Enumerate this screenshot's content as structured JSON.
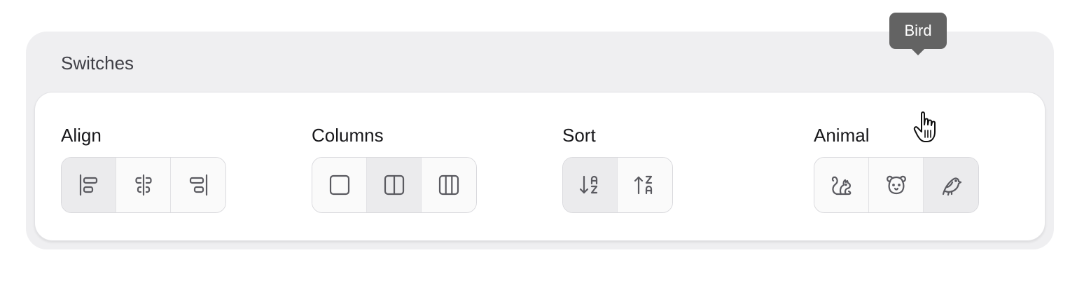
{
  "section_title": "Switches",
  "groups": {
    "align": {
      "label": "Align",
      "options": [
        {
          "icon": "align-left-icon",
          "active": true
        },
        {
          "icon": "align-center-icon",
          "active": false
        },
        {
          "icon": "align-right-icon",
          "active": false
        }
      ]
    },
    "columns": {
      "label": "Columns",
      "options": [
        {
          "icon": "one-column-icon",
          "active": false
        },
        {
          "icon": "two-columns-icon",
          "active": true
        },
        {
          "icon": "three-columns-icon",
          "active": false
        }
      ]
    },
    "sort": {
      "label": "Sort",
      "options": [
        {
          "icon": "sort-ascending-az-icon",
          "active": true
        },
        {
          "icon": "sort-descending-za-icon",
          "active": false
        }
      ]
    },
    "animal": {
      "label": "Animal",
      "options": [
        {
          "icon": "squirrel-icon",
          "active": false
        },
        {
          "icon": "dog-icon",
          "active": false
        },
        {
          "icon": "bird-icon",
          "active": true
        }
      ]
    }
  },
  "tooltip": {
    "text": "Bird"
  },
  "colors": {
    "icon": "#5a5a60",
    "active_bg": "#ebebed",
    "tooltip_bg": "#636363"
  }
}
